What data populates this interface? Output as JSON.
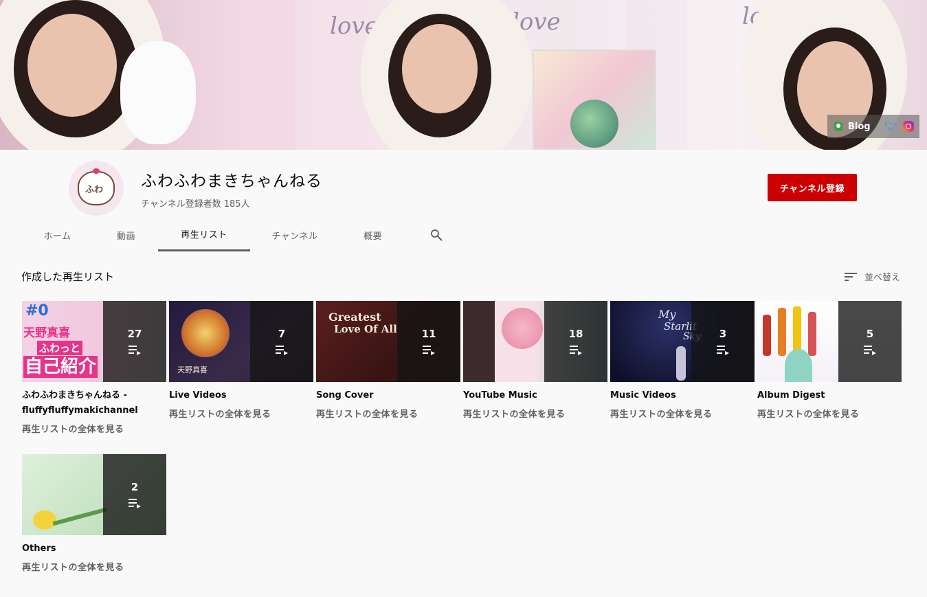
{
  "banner": {
    "decor_text": [
      "love",
      "love",
      "love"
    ],
    "links": {
      "blog_label": "Blog",
      "twitter_icon": "twitter-icon",
      "instagram_icon": "instagram-icon"
    }
  },
  "channel": {
    "name": "ふわふわまきちゃんねる",
    "subscribers": "チャンネル登録者数 185人",
    "subscribe_label": "チャンネル登録",
    "accent_color": "#cc0000"
  },
  "tabs": [
    {
      "label": "ホーム",
      "active": false
    },
    {
      "label": "動画",
      "active": false
    },
    {
      "label": "再生リスト",
      "active": true
    },
    {
      "label": "チャンネル",
      "active": false
    },
    {
      "label": "概要",
      "active": false
    }
  ],
  "content": {
    "section_title": "作成した再生リスト",
    "sort_label": "並べ替え",
    "playlists": [
      {
        "title": "ふわふわまきちゃんねる - fluffyfluffymakichannel",
        "count": "27",
        "link": "再生リストの全体を見る",
        "thumb_text": [
          "#0",
          "天野真喜",
          "ふわっと",
          "自己紹介"
        ]
      },
      {
        "title": "Live Videos",
        "count": "7",
        "link": "再生リストの全体を見る",
        "thumb_text": [
          "天野真喜"
        ]
      },
      {
        "title": "Song Cover",
        "count": "11",
        "link": "再生リストの全体を見る",
        "thumb_text": [
          "Greatest",
          "Love Of All"
        ]
      },
      {
        "title": "YouTube Music",
        "count": "18",
        "link": "再生リストの全体を見る",
        "thumb_text": []
      },
      {
        "title": "Music Videos",
        "count": "3",
        "link": "再生リストの全体を見る",
        "thumb_text": [
          "My",
          "Starlit",
          "Sky"
        ]
      },
      {
        "title": "Album Digest",
        "count": "5",
        "link": "再生リストの全体を見る",
        "thumb_text": []
      },
      {
        "title": "Others",
        "count": "2",
        "link": "再生リストの全体を見る",
        "thumb_text": []
      }
    ]
  }
}
